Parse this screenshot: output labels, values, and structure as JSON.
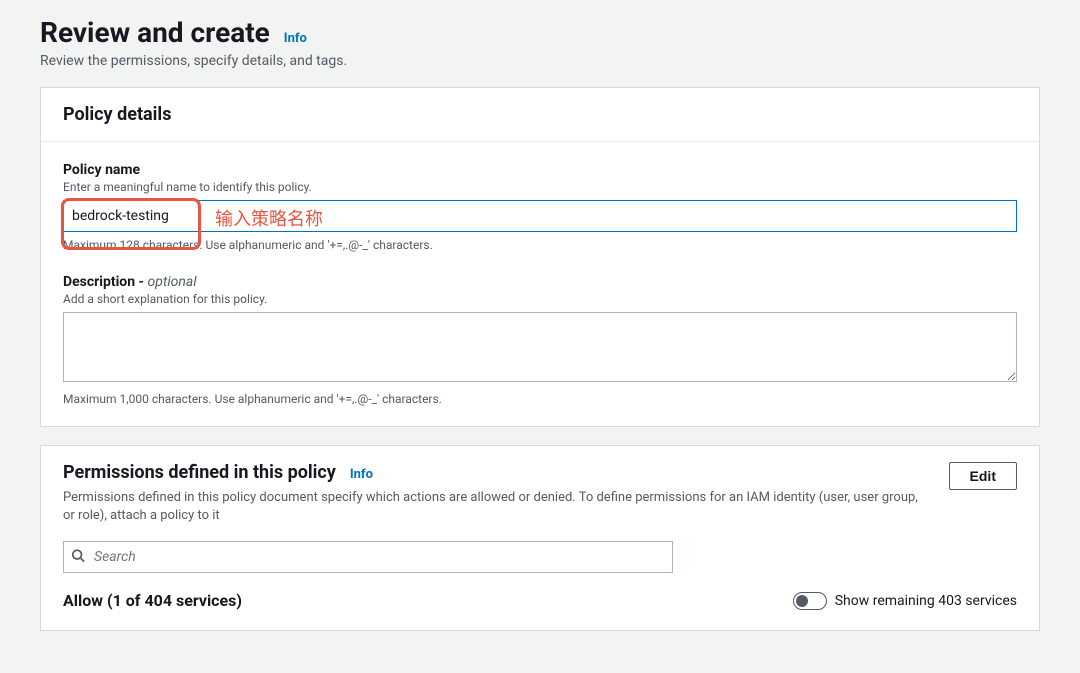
{
  "header": {
    "title": "Review and create",
    "info_label": "Info",
    "subtitle": "Review the permissions, specify details, and tags."
  },
  "policy_details": {
    "panel_title": "Policy details",
    "name_label": "Policy name",
    "name_hint": "Enter a meaningful name to identify this policy.",
    "name_value": "bedrock-testing",
    "name_constraint": "Maximum 128 characters. Use alphanumeric and '+=,.@-_' characters.",
    "description_label": "Description - ",
    "description_optional": "optional",
    "description_hint": "Add a short explanation for this policy.",
    "description_value": "",
    "description_constraint": "Maximum 1,000 characters. Use alphanumeric and '+=,.@-_' characters.",
    "annotation_text": "输入策略名称"
  },
  "permissions": {
    "panel_title": "Permissions defined in this policy",
    "info_label": "Info",
    "description": "Permissions defined in this policy document specify which actions are allowed or denied. To define permissions for an IAM identity (user, user group, or role), attach a policy to it",
    "edit_label": "Edit",
    "search_placeholder": "Search",
    "allow_title": "Allow (1 of 404 services)",
    "toggle_label": "Show remaining 403 services"
  }
}
